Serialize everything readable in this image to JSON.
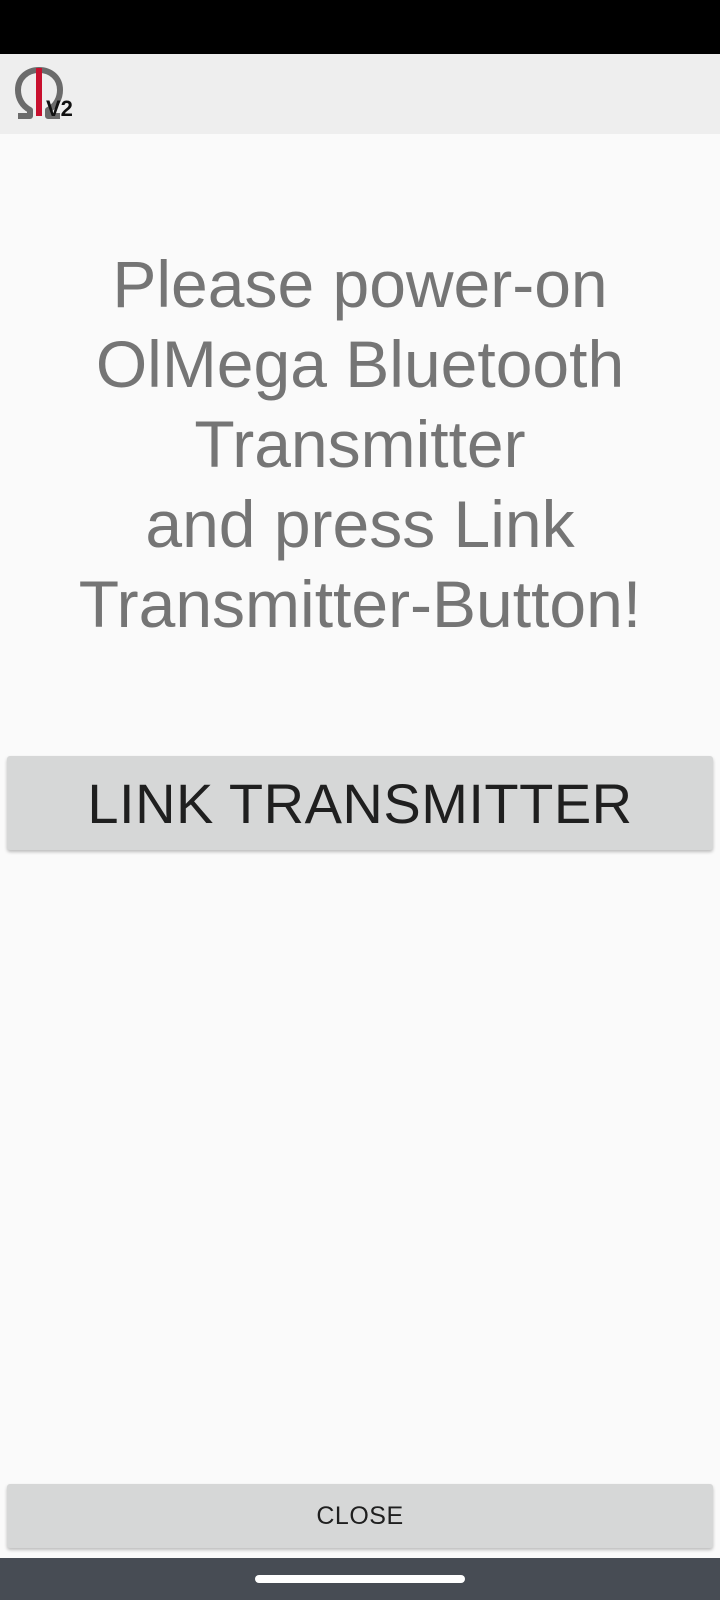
{
  "app_bar": {
    "logo_icon": "omega-icon",
    "logo_version": "V2"
  },
  "main": {
    "instruction": "Please power-on\nOlMega Bluetooth\nTransmitter\nand press Link\nTransmitter-Button!",
    "link_button_label": "LINK TRANSMITTER",
    "close_button_label": "CLOSE"
  },
  "colors": {
    "status_bar": "#000000",
    "app_bar": "#eeeeee",
    "background": "#fafafa",
    "button": "#d6d7d7",
    "instruction_text": "#757575",
    "logo_accent": "#c8102e",
    "nav_bar": "#474c54"
  }
}
